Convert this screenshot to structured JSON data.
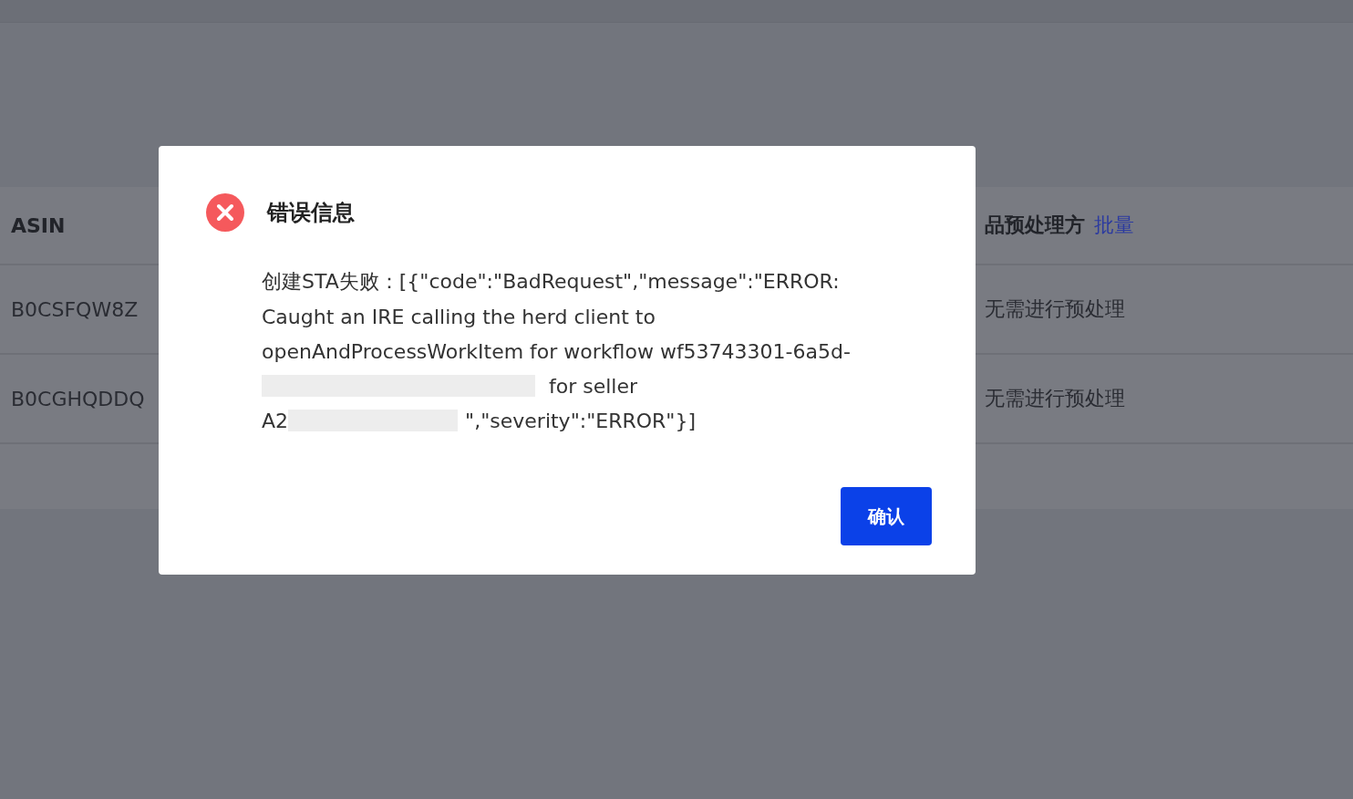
{
  "table": {
    "columns": [
      {
        "label": "ASIN"
      },
      {
        "label": "品预处理方",
        "link": "批量"
      }
    ],
    "rows": [
      {
        "asin": "B0CSFQW8Z",
        "prep": "无需进行预处理"
      },
      {
        "asin": "B0CGHQDDQ",
        "prep": "无需进行预处理"
      }
    ]
  },
  "dialog": {
    "title": "错误信息",
    "lines": [
      [
        {
          "kind": "text",
          "text": "创建STA失败：[{\"code\":\"BadRequest\",\"message\":\"ERROR:"
        }
      ],
      [
        {
          "kind": "text",
          "text": "Caught an IRE calling the herd client to"
        }
      ],
      [
        {
          "kind": "text",
          "text": "openAndProcessWorkItem for workflow wf53743301-6a5d-"
        }
      ],
      [
        {
          "kind": "redacted"
        },
        {
          "kind": "text",
          "text": " for seller"
        }
      ],
      [
        {
          "kind": "text",
          "text": "A2"
        },
        {
          "kind": "redacted"
        },
        {
          "kind": "text",
          "text": "\",\"severity\":\"ERROR\"}]"
        }
      ]
    ],
    "button": "确认"
  }
}
